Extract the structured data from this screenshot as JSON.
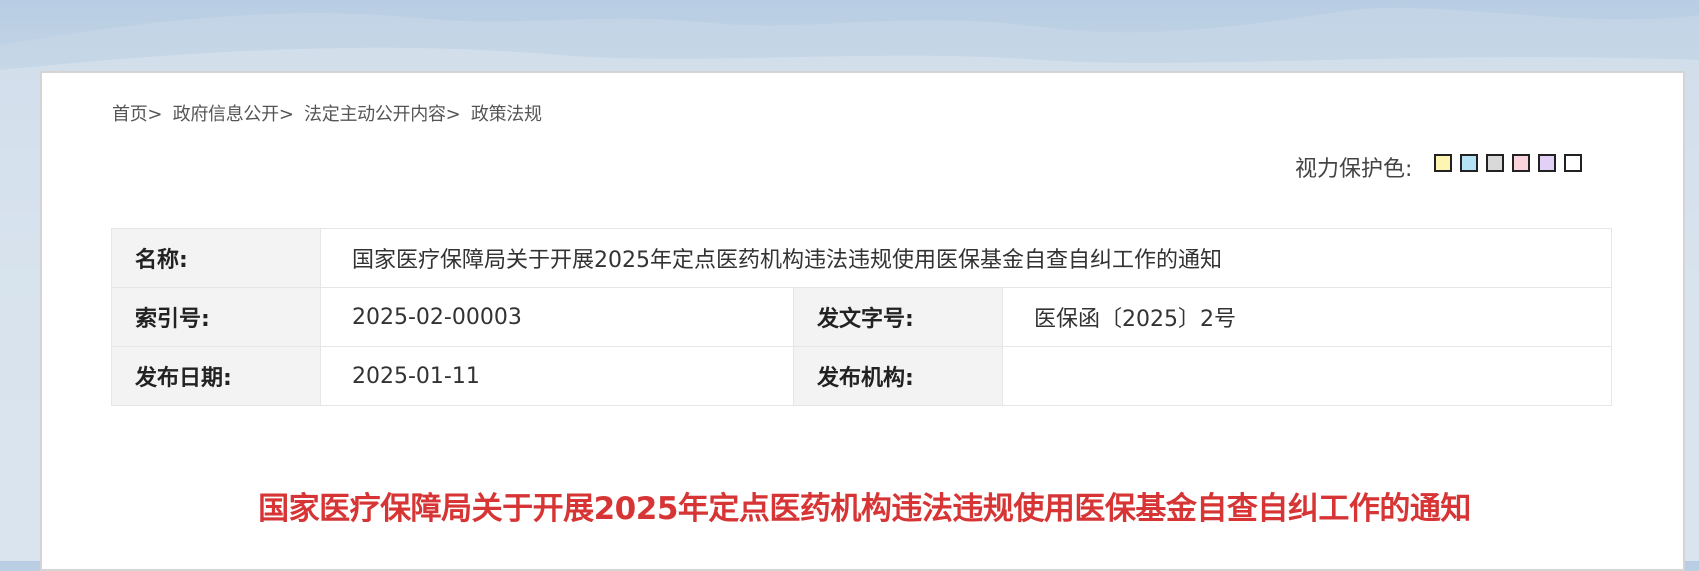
{
  "breadcrumb": [
    {
      "label": "首页"
    },
    {
      "label": "政府信息公开"
    },
    {
      "label": "法定主动公开内容"
    },
    {
      "label": "政策法规"
    }
  ],
  "breadcrumb_separator": ">",
  "eye_protection": {
    "label": "视力保护色:",
    "colors": [
      "#fff5b3",
      "#b6e2f5",
      "#d9d9d9",
      "#f9d4dd",
      "#e3d0f7",
      "#ffffff"
    ]
  },
  "meta": {
    "name_label": "名称:",
    "name_value": "国家医疗保障局关于开展2025年定点医药机构违法违规使用医保基金自查自纠工作的通知",
    "index_label": "索引号:",
    "index_value": "2025-02-00003",
    "docno_label": "发文字号:",
    "docno_value": "医保函〔2025〕2号",
    "date_label": "发布日期:",
    "date_value": "2025-01-11",
    "org_label": "发布机构:",
    "org_value": ""
  },
  "title": "国家医疗保障局关于开展2025年定点医药机构违法违规使用医保基金自查自纠工作的通知",
  "colors": {
    "title_red": "#d73535"
  }
}
